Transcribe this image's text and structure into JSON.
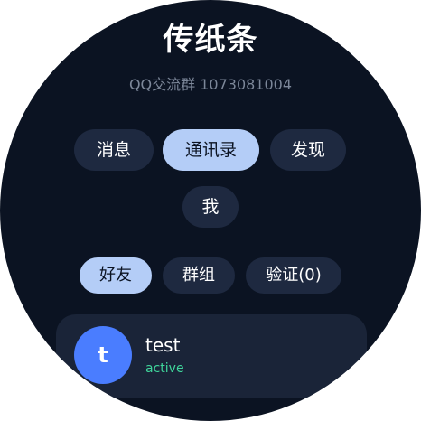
{
  "app": {
    "title": "传纸条",
    "subtitle": "QQ交流群 1073081004"
  },
  "main_tabs": [
    {
      "label": "消息",
      "active": false
    },
    {
      "label": "通讯录",
      "active": true
    },
    {
      "label": "发现",
      "active": false
    },
    {
      "label": "我",
      "active": false
    }
  ],
  "contact_tabs": [
    {
      "label": "好友",
      "active": true
    },
    {
      "label": "群组",
      "active": false
    },
    {
      "label": "验证(0)",
      "active": false
    }
  ],
  "contacts": [
    {
      "avatar_letter": "t",
      "name": "test",
      "status": "active"
    }
  ],
  "colors": {
    "background": "#0b1322",
    "pill": "#1e2940",
    "pill_active": "#b4cdf7",
    "card": "#1a2438",
    "avatar": "#4a7dff",
    "status_active": "#3fd59b",
    "subtitle": "#7c8799"
  }
}
